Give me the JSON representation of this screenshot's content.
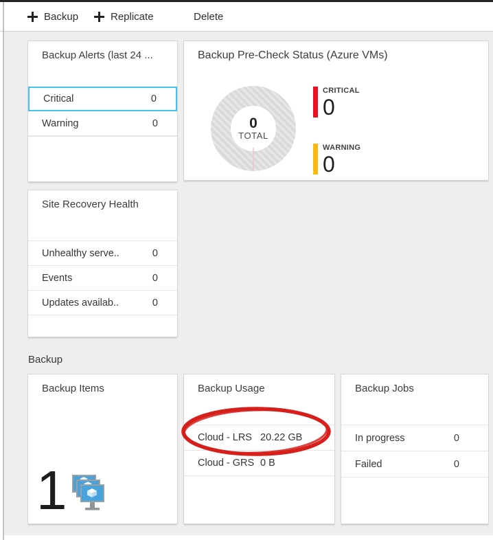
{
  "toolbar": {
    "backup_label": "Backup",
    "replicate_label": "Replicate",
    "delete_label": "Delete"
  },
  "alerts_tile": {
    "title": "Backup Alerts (last 24 ...",
    "rows": [
      {
        "label": "Critical",
        "value": "0"
      },
      {
        "label": "Warning",
        "value": "0"
      }
    ]
  },
  "precheck_tile": {
    "title": "Backup Pre-Check Status (Azure VMs)",
    "donut": {
      "total_value": "0",
      "total_label": "TOTAL"
    },
    "legend": [
      {
        "label": "CRITICAL",
        "value": "0",
        "color": "#e81123"
      },
      {
        "label": "WARNING",
        "value": "0",
        "color": "#fcb813"
      }
    ]
  },
  "site_recovery_tile": {
    "title": "Site Recovery Health",
    "rows": [
      {
        "label": "Unhealthy serve..",
        "value": "0"
      },
      {
        "label": "Events",
        "value": "0"
      },
      {
        "label": "Updates availab..",
        "value": "0"
      }
    ]
  },
  "backup_section": {
    "label": "Backup"
  },
  "items_tile": {
    "title": "Backup Items",
    "count": "1"
  },
  "usage_tile": {
    "title": "Backup Usage",
    "rows": [
      {
        "label": "Cloud - LRS",
        "value": "20.22 GB"
      },
      {
        "label": "Cloud - GRS",
        "value": "0 B"
      }
    ]
  },
  "jobs_tile": {
    "title": "Backup Jobs",
    "rows": [
      {
        "label": "In progress",
        "value": "0"
      },
      {
        "label": "Failed",
        "value": "0"
      }
    ]
  },
  "annotation": {
    "type": "red-ellipse",
    "color": "#d6201b"
  },
  "colors": {
    "selected_row_border": "#44c2ed",
    "critical_bar": "#e81123",
    "warning_bar": "#fcb813",
    "donut_ring": "#dadada",
    "donut_tick": "#edc6cf",
    "content_bg": "#eeeeee",
    "top_edge": "#262626"
  }
}
